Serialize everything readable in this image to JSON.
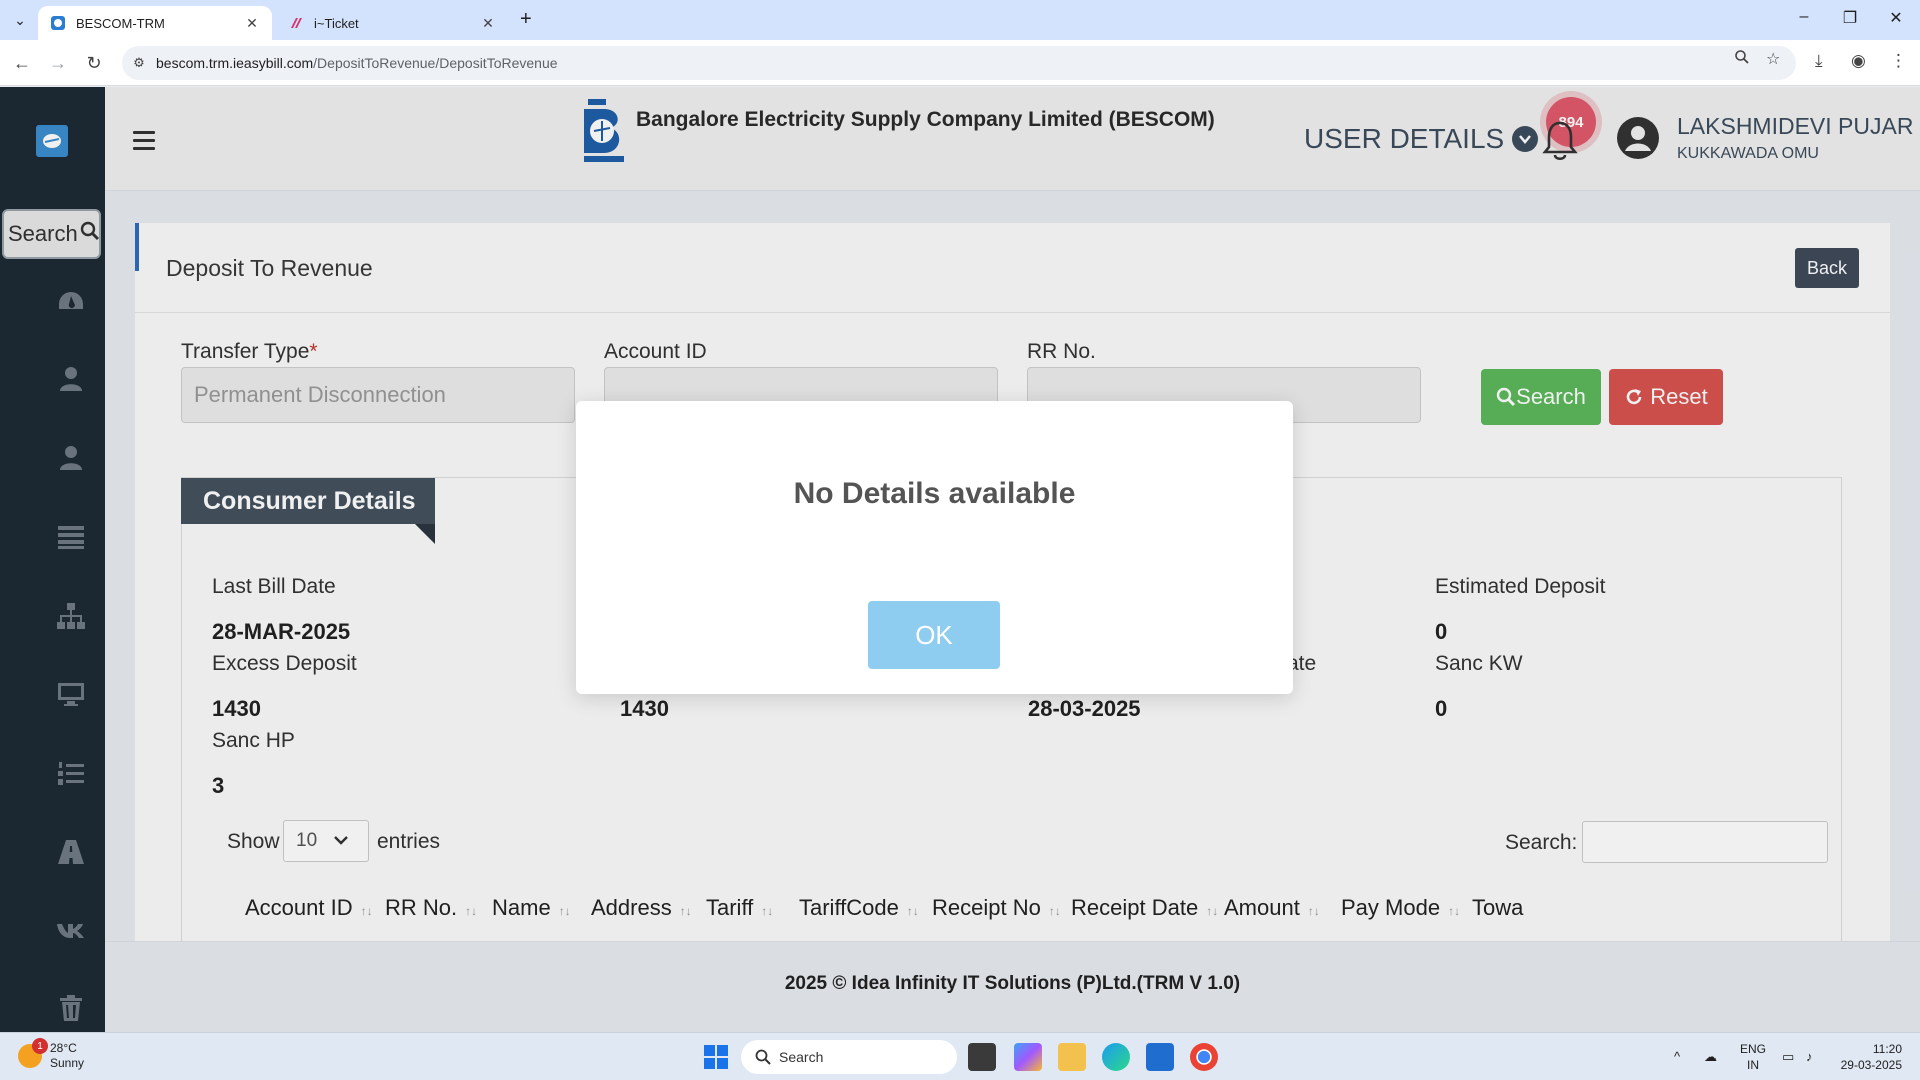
{
  "browser": {
    "tabs": [
      {
        "title": "BESCOM-TRM",
        "active": true
      },
      {
        "title": "i~Ticket",
        "active": false
      }
    ],
    "url_host": "bescom.trm.ieasybill.com",
    "url_path": "/DepositToRevenue/DepositToRevenue"
  },
  "sidebar": {
    "search_label": "Search",
    "icons": [
      "dashboard-icon",
      "user-icon",
      "user-icon",
      "list-icon",
      "sitemap-icon",
      "monitor-icon",
      "ordered-list-icon",
      "road-icon",
      "vk-icon",
      "trash-icon"
    ]
  },
  "header": {
    "company": "Bangalore Electricity Supply Company Limited (BESCOM)",
    "user_details_label": "USER DETAILS",
    "notifications_count": "894",
    "user_name": "LAKSHMIDEVI PUJAR",
    "user_sub": "KUKKAWADA OMU"
  },
  "page": {
    "title": "Deposit To Revenue",
    "back_label": "Back"
  },
  "form": {
    "transfer_type_label": "Transfer Type",
    "required_mark": "*",
    "transfer_type_value": "Permanent Disconnection",
    "account_id_label": "Account ID",
    "rr_no_label": "RR No.",
    "search_button": "Search",
    "reset_button": "Reset"
  },
  "consumer": {
    "section_title": "Consumer Details",
    "last_bill_date_label": "Last Bill Date",
    "last_bill_date": "28-MAR-2025",
    "estimated_deposit_label": "Estimated Deposit",
    "estimated_deposit": "0",
    "excess_deposit_label": "Excess Deposit",
    "excess_deposit": "1430",
    "col2_value": "1430",
    "partial_label": "ate",
    "col3_value": "28-03-2025",
    "sanc_kw_label": "Sanc KW",
    "sanc_kw": "0",
    "sanc_hp_label": "Sanc HP",
    "sanc_hp": "3"
  },
  "table": {
    "show_label": "Show",
    "entries_value": "10",
    "entries_label": "entries",
    "search_label": "Search:",
    "columns": [
      "Account ID",
      "RR No.",
      "Name",
      "Address",
      "Tariff",
      "TariffCode",
      "Receipt No",
      "Receipt Date",
      "Amount",
      "Pay Mode",
      "Towa"
    ]
  },
  "footer": {
    "text": "2025 © Idea Infinity IT Solutions (P)Ltd.(TRM V 1.0)"
  },
  "modal": {
    "message": "No Details available",
    "ok_label": "OK"
  },
  "taskbar": {
    "weather_badge": "1",
    "temperature": "28°C",
    "condition": "Sunny",
    "search_placeholder": "Search",
    "lang_line1": "ENG",
    "lang_line2": "IN",
    "time": "11:20",
    "date": "29-03-2025"
  }
}
